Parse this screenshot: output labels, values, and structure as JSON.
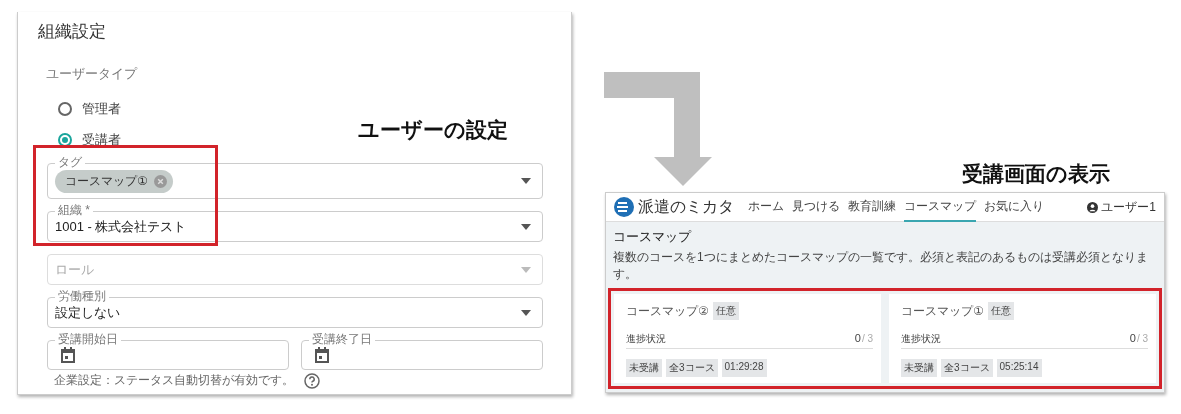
{
  "callouts": [
    {
      "label": "ユーザーの設定"
    },
    {
      "label": "受講画面の表示"
    }
  ],
  "settings_panel": {
    "title": "組織設定",
    "user_type_label": "ユーザータイプ",
    "radios": [
      {
        "label": "管理者",
        "selected": false
      },
      {
        "label": "受講者",
        "selected": true
      }
    ],
    "fields": [
      {
        "kind": "chips",
        "label": "タグ",
        "chips": [
          "コースマップ①"
        ]
      },
      {
        "kind": "select",
        "label": "組織 *",
        "value": "1001 - 株式会社テスト"
      },
      {
        "kind": "select",
        "placeholder": "ロール",
        "disabled": true
      },
      {
        "kind": "select",
        "label": "労働種別",
        "value": "設定しない"
      }
    ],
    "date_fields": [
      {
        "label": "受講開始日"
      },
      {
        "label": "受講終了日"
      }
    ],
    "note": "企業設定：ステータス自動切替が有効です。"
  },
  "learner_view": {
    "logo_text": "派遣のミカタ",
    "nav": [
      {
        "label": "ホーム",
        "selected": false
      },
      {
        "label": "見つける",
        "selected": false
      },
      {
        "label": "教育訓練",
        "selected": false
      },
      {
        "label": "コースマップ",
        "selected": true
      },
      {
        "label": "お気に入り",
        "selected": false
      }
    ],
    "user": "ユーザー1",
    "page_title": "コースマップ",
    "description": "複数のコースを1つにまとめたコースマップの一覧です。必須と表記のあるものは受講必須となります。",
    "cards": [
      {
        "title": "コースマップ②",
        "badge": "任意",
        "progress_label": "進捗状況",
        "done": "0",
        "total": "/ 3",
        "tags": [
          "未受講",
          "全3コース",
          "01:29:28"
        ]
      },
      {
        "title": "コースマップ①",
        "badge": "任意",
        "progress_label": "進捗状況",
        "done": "0",
        "total": "/ 3",
        "tags": [
          "未受講",
          "全3コース",
          "05:25:14"
        ]
      }
    ]
  }
}
